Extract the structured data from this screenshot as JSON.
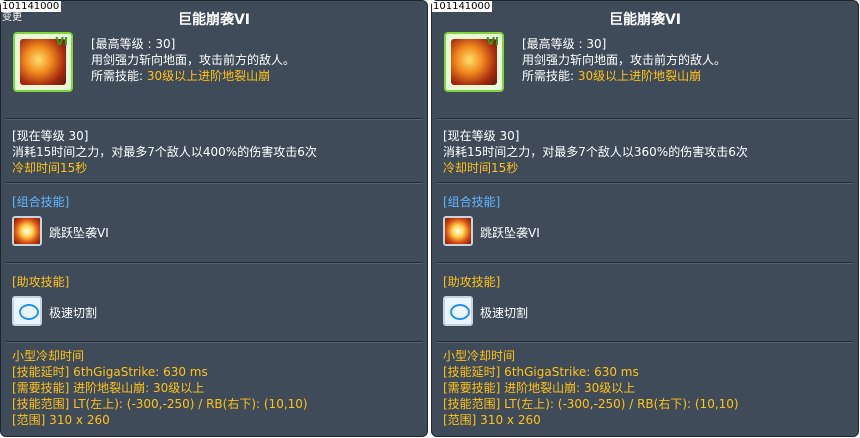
{
  "panels": [
    {
      "id": "101141000",
      "change_label": "变更",
      "title": "巨能崩袭VI",
      "icon": "sword-fire-skill-icon",
      "icon_corner": "VI",
      "max_level": "[最高等级 : 30]",
      "description": "用剑强力斩向地面，攻击前方的敌人。",
      "required_prefix": "所需技能:",
      "required_value": "30级以上进阶地裂山崩",
      "current_level": "[现在等级 30]",
      "effect": "消耗15时间之力，对最多7个敌人以400%的伤害攻击6次",
      "cooldown": "冷却时间15秒",
      "combo_header": "[组合技能]",
      "combo_skill": "跳跃坠袭VI",
      "assist_header": "[助攻技能]",
      "assist_skill": "极速切割",
      "info_lines": [
        "小型冷却时间",
        "[技能延时] 6thGigaStrike: 630 ms",
        "[需要技能] 进阶地裂山崩: 30级以上",
        "[技能范围] LT(左上): (-300,-250) / RB(右下): (10,10)",
        "[范围] 310 x 260"
      ]
    },
    {
      "id": "101141000",
      "title": "巨能崩袭VI",
      "icon": "sword-fire-skill-icon",
      "icon_corner": "VI",
      "max_level": "[最高等级 : 30]",
      "description": "用剑强力斩向地面，攻击前方的敌人。",
      "required_prefix": "所需技能:",
      "required_value": "30级以上进阶地裂山崩",
      "current_level": "[现在等级 30]",
      "effect": "消耗15时间之力，对最多7个敌人以360%的伤害攻击6次",
      "cooldown": "冷却时间15秒",
      "combo_header": "[组合技能]",
      "combo_skill": "跳跃坠袭VI",
      "assist_header": "[助攻技能]",
      "assist_skill": "极速切割",
      "info_lines": [
        "小型冷却时间",
        "[技能延时] 6thGigaStrike: 630 ms",
        "[需要技能] 进阶地裂山崩: 30级以上",
        "[技能范围] LT(左上): (-300,-250) / RB(右下): (10,10)",
        "[范围] 310 x 260"
      ]
    }
  ],
  "colors": {
    "panel_bg": "#3f4b59",
    "gold_text": "#ffc21a",
    "blue_header": "#63b6ff",
    "icon_border": "#7dd63a"
  }
}
